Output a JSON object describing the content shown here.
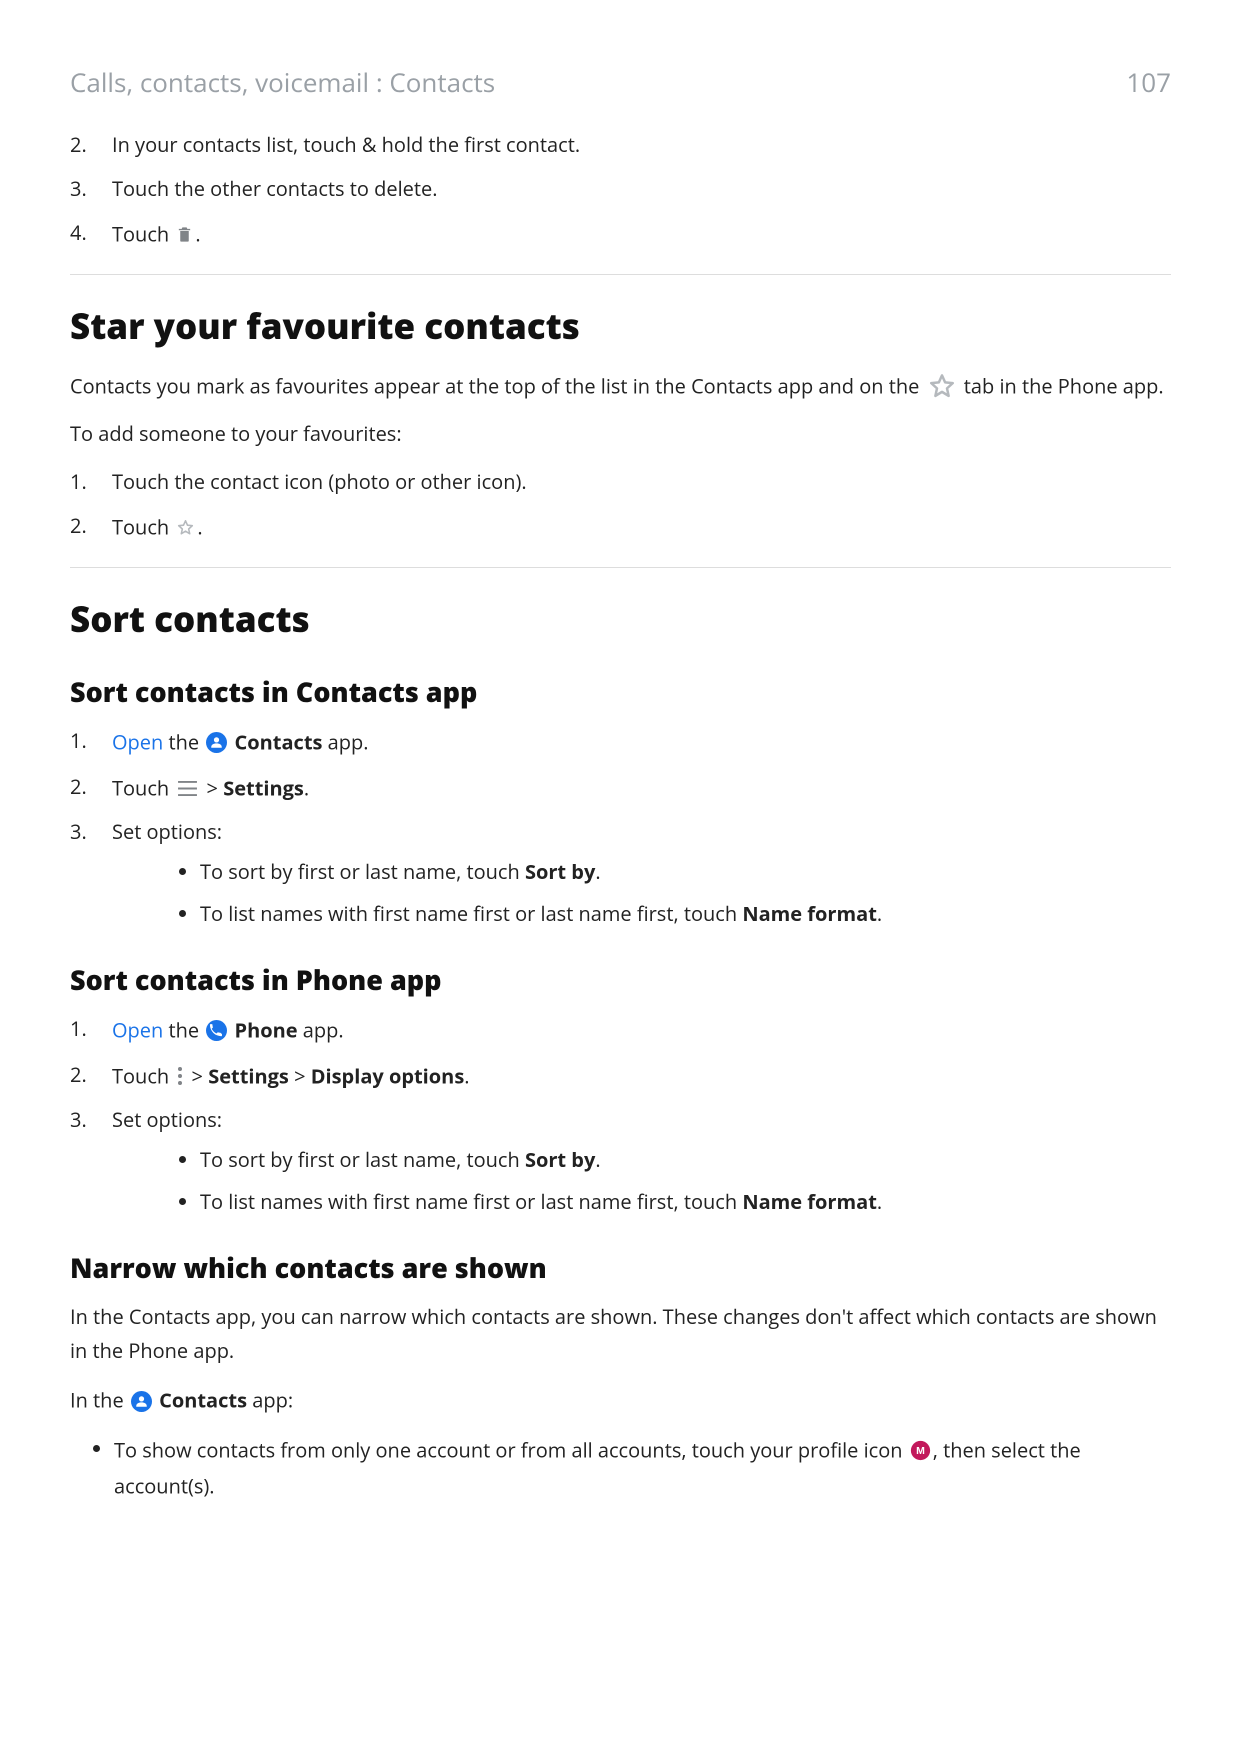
{
  "header": {
    "breadcrumb": "Calls, contacts, voicemail : Contacts",
    "pageNumber": "107"
  },
  "topList": {
    "item2": "In your contacts list, touch & hold the first contact.",
    "item3": "Touch the other contacts to delete.",
    "item4_pre": "Touch ",
    "item4_post": "."
  },
  "section1": {
    "heading": "Star your favourite contacts",
    "para1_pre": "Contacts you mark as favourites appear at the top of the list in the Contacts app and on the ",
    "para1_post": " tab in the Phone app.",
    "para2": "To add someone to your favourites:",
    "step1": "Touch the contact icon (photo or other icon).",
    "step2_pre": "Touch ",
    "step2_post": "."
  },
  "section2": {
    "heading": "Sort contacts",
    "sub1": {
      "heading": "Sort contacts in Contacts app",
      "step1_open": "Open",
      "step1_the": " the ",
      "step1_app": "Contacts",
      "step1_suffix": " app.",
      "step2_pre": "Touch ",
      "step2_gt": " > ",
      "step2_settings": "Settings",
      "step2_post": ".",
      "step3": "Set options:",
      "bullet1_pre": "To sort by first or last name, touch ",
      "bullet1_bold": "Sort by",
      "bullet1_post": ".",
      "bullet2_pre": "To list names with first name first or last name first, touch ",
      "bullet2_bold": "Name format",
      "bullet2_post": "."
    },
    "sub2": {
      "heading": "Sort contacts in Phone app",
      "step1_open": "Open",
      "step1_the": " the ",
      "step1_app": "Phone",
      "step1_suffix": " app.",
      "step2_pre": "Touch ",
      "step2_gt1": " > ",
      "step2_settings": "Settings",
      "step2_gt2": " > ",
      "step2_display": "Display options",
      "step2_post": ".",
      "step3": "Set options:",
      "bullet1_pre": "To sort by first or last name, touch ",
      "bullet1_bold": "Sort by",
      "bullet1_post": ".",
      "bullet2_pre": "To list names with first name first or last name first, touch ",
      "bullet2_bold": "Name format",
      "bullet2_post": "."
    },
    "sub3": {
      "heading": "Narrow which contacts are shown",
      "para1": "In the Contacts app, you can narrow which contacts are shown. These changes don't affect which contacts are shown in the Phone app.",
      "para2_pre": "In the ",
      "para2_app": "Contacts",
      "para2_post": " app:",
      "bullet1_pre": "To show contacts from only one account or from all accounts, touch your profile icon ",
      "bullet1_post": ", then select the account(s)."
    }
  },
  "icons": {
    "trash": "trash-icon",
    "starOutlineLarge": "star-outline-icon",
    "starOutlineSmall": "star-outline-icon",
    "contactsApp": "contacts-app-icon",
    "phoneApp": "phone-app-icon",
    "hamburger": "menu-icon",
    "moreVert": "more-vertical-icon",
    "profileLetter": "M",
    "profile": "profile-avatar-icon"
  }
}
